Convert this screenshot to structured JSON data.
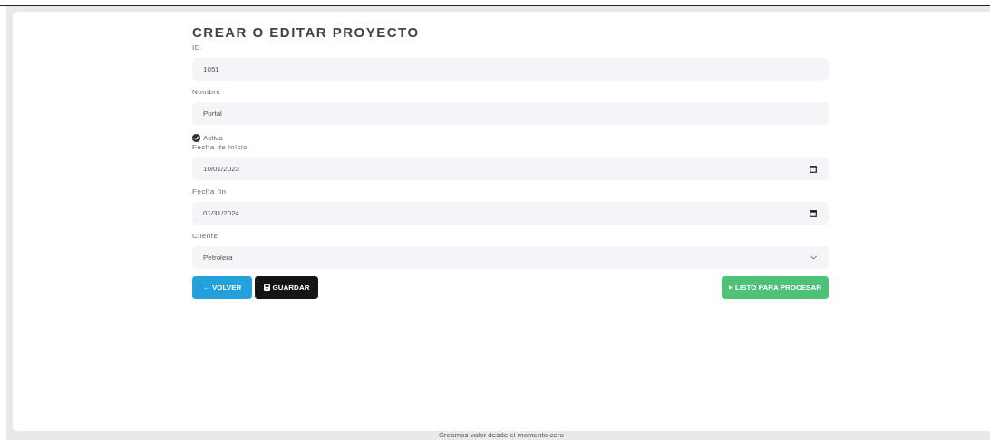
{
  "title": "CREAR O EDITAR PROYECTO",
  "fields": [
    {
      "kind": "text",
      "label": "ID",
      "value": "1051"
    },
    {
      "kind": "text",
      "label": "Nombre",
      "value": "Portal"
    },
    {
      "kind": "checkbox",
      "label": "Activo",
      "checked": true
    },
    {
      "kind": "date",
      "label": "Fecha de inicio",
      "value": "10/01/2023"
    },
    {
      "kind": "date",
      "label": "Fecha fin",
      "value": "01/31/2024"
    },
    {
      "kind": "select",
      "label": "Cliente",
      "value": "Petrolera"
    }
  ],
  "buttons": [
    {
      "kind": "back",
      "label": "← VOLVER"
    },
    {
      "kind": "save",
      "label": "GUARDAR"
    },
    {
      "kind": "process",
      "label": "LISTO PARA PROCESAR"
    }
  ],
  "footer": "Creamos valor desde el momento cero"
}
